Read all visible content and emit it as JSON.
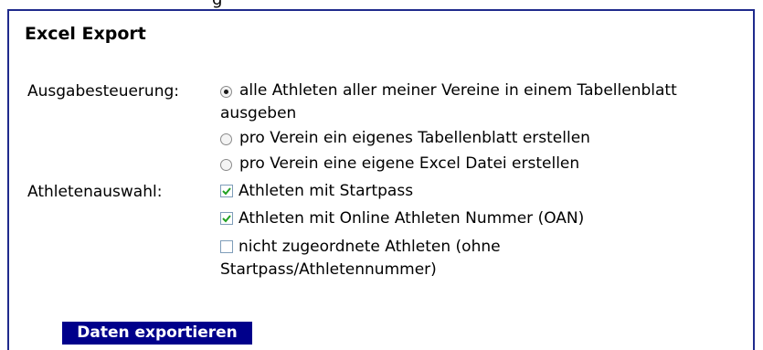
{
  "top_strip_text": "g",
  "panel": {
    "title": "Excel Export"
  },
  "output_control": {
    "label": "Ausgabesteuerung:",
    "options": [
      {
        "line1": "alle Athleten aller meiner Vereine in einem Tabellenblatt",
        "line2": "ausgeben",
        "checked": true
      },
      {
        "line1": "pro Verein ein eigenes Tabellenblatt erstellen",
        "checked": false
      },
      {
        "line1": "pro Verein eine eigene Excel Datei erstellen",
        "checked": false
      }
    ]
  },
  "athlete_selection": {
    "label": "Athletenauswahl:",
    "options": [
      {
        "line1": "Athleten mit Startpass",
        "checked": true
      },
      {
        "line1": "Athleten mit Online Athleten Nummer (OAN)",
        "checked": true
      },
      {
        "line1": "nicht zugeordnete Athleten (ohne",
        "line2": "Startpass/Athletennummer)",
        "checked": false
      }
    ]
  },
  "export_button": {
    "label": "Daten exportieren"
  },
  "colors": {
    "border": "#1f2a8c",
    "button_bg": "#00008b",
    "button_text": "#ffffff"
  }
}
